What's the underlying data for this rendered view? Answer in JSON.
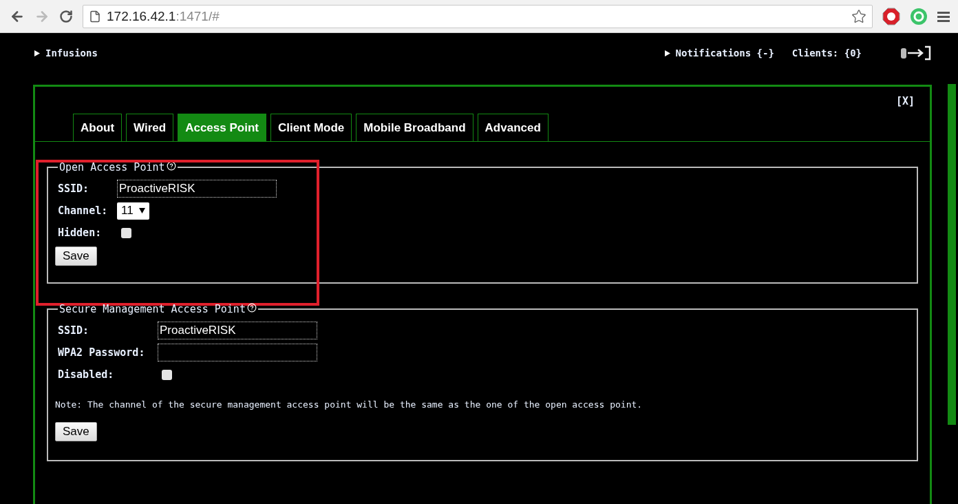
{
  "browser": {
    "url_host": "172.16.42.1",
    "url_path": ":1471/#",
    "back_disabled": false,
    "forward_disabled": true
  },
  "top_bar": {
    "infusions": "Infusions",
    "notifications": "Notifications {-}",
    "clients": "Clients: {0}"
  },
  "panel": {
    "close": "[X]",
    "tabs": [
      {
        "label": "About",
        "selected": false
      },
      {
        "label": "Wired",
        "selected": false
      },
      {
        "label": "Access Point",
        "selected": true
      },
      {
        "label": "Client Mode",
        "selected": false
      },
      {
        "label": "Mobile Broadband",
        "selected": false
      },
      {
        "label": "Advanced",
        "selected": false
      }
    ],
    "sections": [
      {
        "title": "Open Access Point",
        "highlighted": true,
        "fields": [
          {
            "kind": "text",
            "label": "SSID:",
            "value": "ProactiveRISK"
          },
          {
            "kind": "select",
            "label": "Channel:",
            "value": "11"
          },
          {
            "kind": "checkbox",
            "label": "Hidden:",
            "checked": false
          }
        ],
        "button": "Save"
      },
      {
        "title": "Secure Management Access Point",
        "highlighted": false,
        "fields": [
          {
            "kind": "text",
            "label": "SSID:",
            "value": "ProactiveRISK"
          },
          {
            "kind": "password",
            "label": "WPA2 Password:"
          },
          {
            "kind": "checkbox",
            "label": "Disabled:",
            "checked": false
          }
        ],
        "note": "Note: The channel of the secure management access point will be the same as the one of the open access point.",
        "button": "Save"
      }
    ]
  }
}
